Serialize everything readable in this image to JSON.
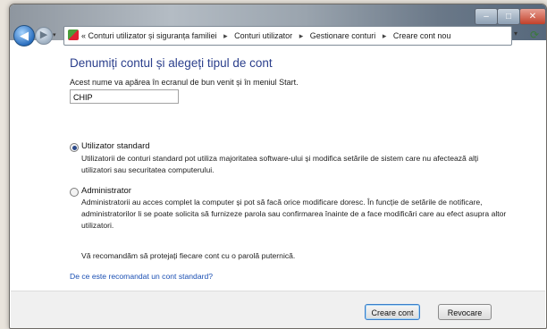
{
  "window": {
    "titlebar_buttons": {
      "minimize": "–",
      "maximize": "□",
      "close": "✕"
    }
  },
  "nav": {
    "back_icon": "◀",
    "forward_icon": "▶",
    "history_icon": "▾",
    "address_prefix": "«",
    "breadcrumbs": [
      "Conturi utilizator și siguranța familiei",
      "Conturi utilizator",
      "Gestionare conturi",
      "Creare cont nou"
    ],
    "separator": "▸",
    "dropdown_icon": "▾",
    "refresh_icon": "⟳"
  },
  "main": {
    "heading": "Denumiți contul și alegeți tipul de cont",
    "description": "Acest nume va apărea în ecranul de bun venit și în meniul Start.",
    "name_value": "CHIP",
    "options": [
      {
        "label": "Utilizator standard",
        "selected": true,
        "description": "Utilizatorii de conturi standard pot utiliza majoritatea software-ului și modifica setările de sistem care nu afectează alți utilizatori sau securitatea computerului."
      },
      {
        "label": "Administrator",
        "selected": false,
        "description": "Administratorii au acces complet la computer și pot să facă orice modificare doresc. În funcție de setările de notificare, administratorilor li se poate solicita să furnizeze parola sau confirmarea înainte de a face modificări care au efect asupra altor utilizatori."
      }
    ],
    "recommendation": "Vă recomandăm să protejați fiecare cont cu o parolă puternică.",
    "help_link": "De ce este recomandat un cont standard?"
  },
  "footer": {
    "create_label": "Creare cont",
    "cancel_label": "Revocare"
  },
  "colors": {
    "heading": "#2b3f8c",
    "link": "#1a4fb3"
  }
}
